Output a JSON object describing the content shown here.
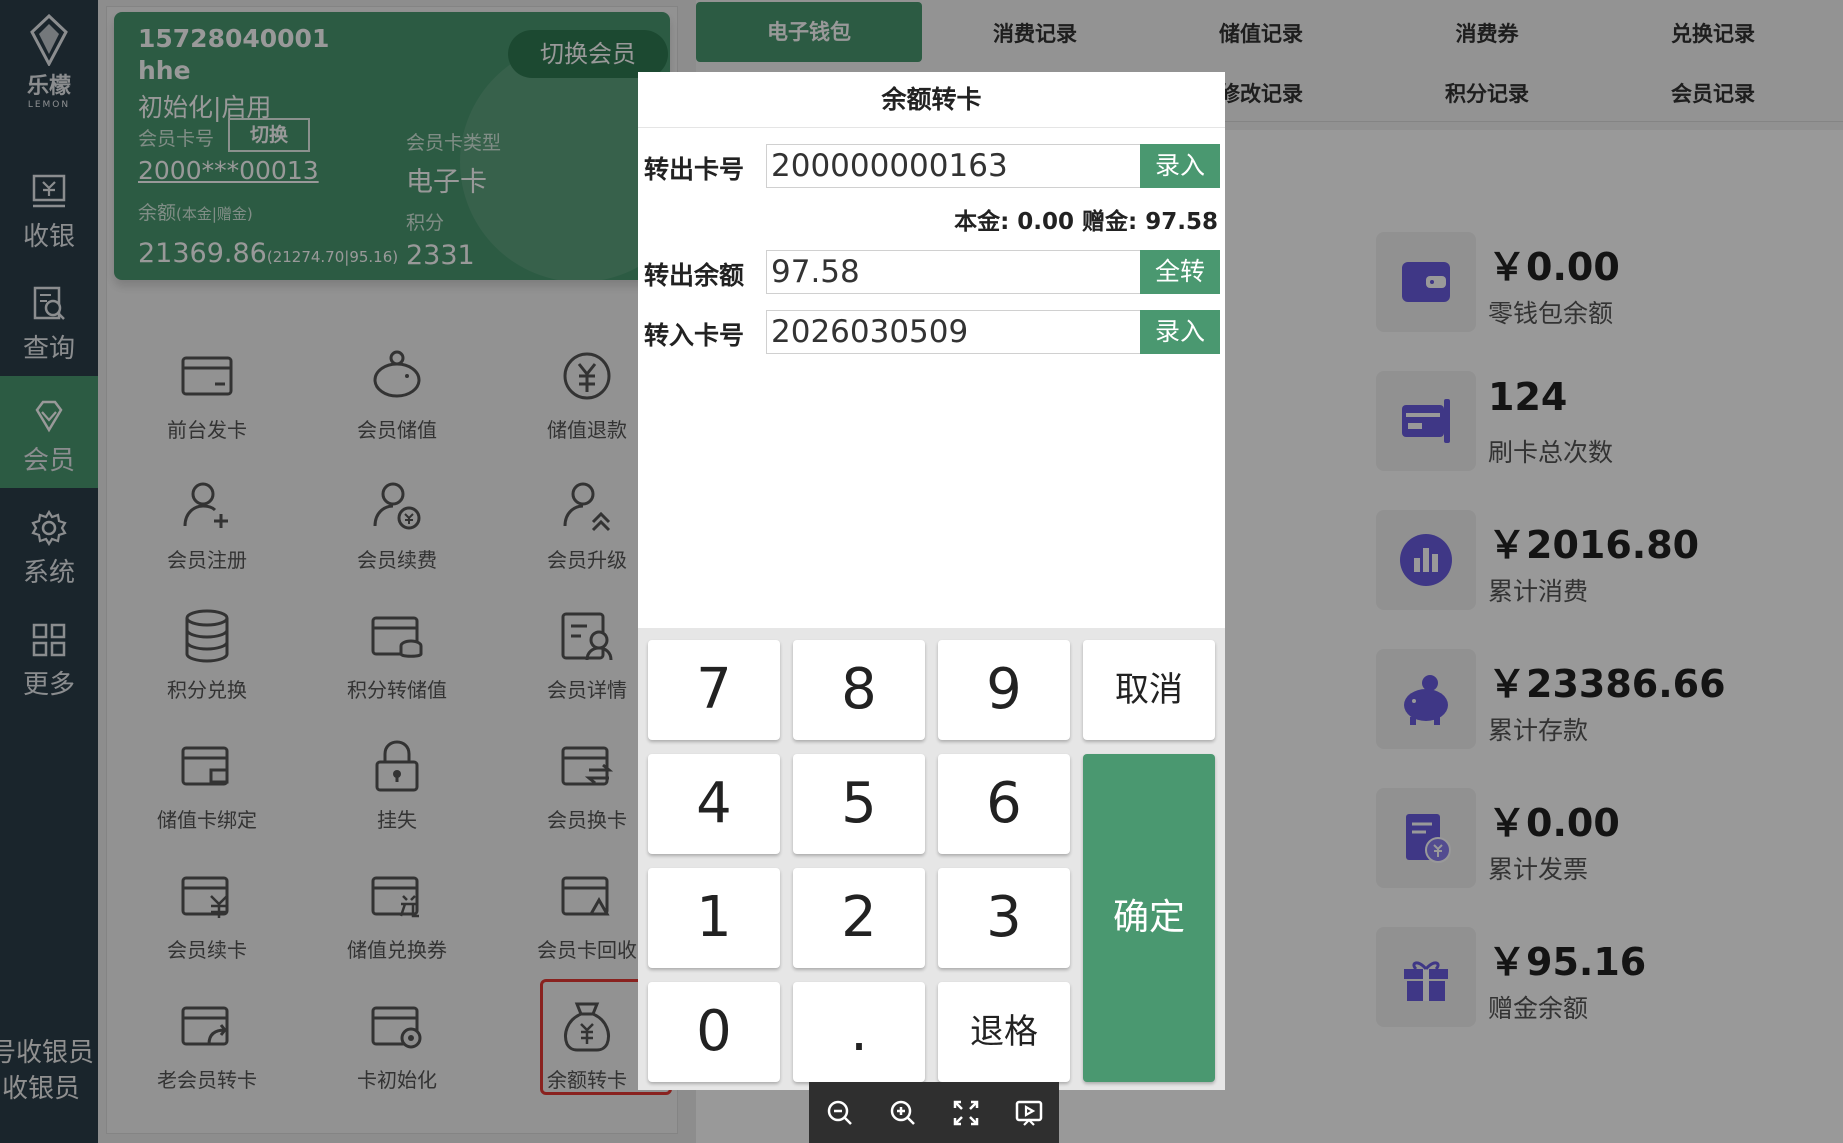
{
  "nav": {
    "logo_cn": "乐檬",
    "logo_en": "LEMON",
    "items": [
      {
        "label": "收银"
      },
      {
        "label": "查询"
      },
      {
        "label": "会员"
      },
      {
        "label": "系统"
      },
      {
        "label": "更多"
      }
    ],
    "cashier_line1": "号收银员",
    "cashier_line2": "收银员"
  },
  "card": {
    "phone": "15728040001",
    "name": "hhe",
    "status": "初始化|启用",
    "card_no_label": "会员卡号",
    "switch_label": "切换",
    "card_no": "2000***00013",
    "card_type_label": "会员卡类型",
    "card_type": "电子卡",
    "balance_label": "余额",
    "balance_sub": "(本金|赠金)",
    "balance": "21369.86",
    "balance_detail": "(21274.70|95.16)",
    "points_label": "积分",
    "points": "2331",
    "switch_member_label": "切换会员"
  },
  "tiles": [
    {
      "label": "前台发卡",
      "icon": "card-icon"
    },
    {
      "label": "会员储值",
      "icon": "piggy-bank-icon"
    },
    {
      "label": "储值退款",
      "icon": "yuan-refund-icon"
    },
    {
      "label": "会员注册",
      "icon": "user-add-icon"
    },
    {
      "label": "会员续费",
      "icon": "user-yuan-icon"
    },
    {
      "label": "会员升级",
      "icon": "user-upgrade-icon"
    },
    {
      "label": "积分兑换",
      "icon": "coins-stack-icon"
    },
    {
      "label": "积分转储值",
      "icon": "card-transfer-icon"
    },
    {
      "label": "会员详情",
      "icon": "user-detail-icon"
    },
    {
      "label": "储值卡绑定",
      "icon": "card-bind-icon"
    },
    {
      "label": "挂失",
      "icon": "lock-icon"
    },
    {
      "label": "会员换卡",
      "icon": "card-swap-icon"
    },
    {
      "label": "会员续卡",
      "icon": "card-renew-icon"
    },
    {
      "label": "储值兑换券",
      "icon": "card-coupon-icon"
    },
    {
      "label": "会员卡回收",
      "icon": "card-recycle-icon"
    },
    {
      "label": "老会员转卡",
      "icon": "card-forward-icon"
    },
    {
      "label": "卡初始化",
      "icon": "card-reset-icon"
    },
    {
      "label": "余额转卡",
      "icon": "money-bag-icon"
    }
  ],
  "tabs": [
    {
      "label": "电子钱包"
    },
    {
      "label": "消费记录"
    },
    {
      "label": "储值记录"
    },
    {
      "label": "消费券"
    },
    {
      "label": "兑换记录"
    },
    {
      "label": "修改记录"
    },
    {
      "label": "积分记录"
    },
    {
      "label": "会员记录"
    }
  ],
  "stats": [
    {
      "value": "￥0.00",
      "label": "零钱包余额",
      "icon": "wallet-icon"
    },
    {
      "value": "124",
      "label": "刷卡总次数",
      "icon": "card-swipe-icon"
    },
    {
      "value": "￥2016.80",
      "label": "累计消费",
      "icon": "bar-chart-icon"
    },
    {
      "value": "￥23386.66",
      "label": "累计存款",
      "icon": "piggy-bank-icon"
    },
    {
      "value": "￥0.00",
      "label": "累计发票",
      "icon": "invoice-icon"
    },
    {
      "value": "￥95.16",
      "label": "赠金余额",
      "icon": "gift-icon"
    }
  ],
  "dialog": {
    "title": "余额转卡",
    "out_card_label": "转出卡号",
    "out_card_value": "200000000163",
    "enter_label": "录入",
    "balance_info": "本金:  0.00 赠金:  97.58",
    "out_amount_label": "转出余额",
    "out_amount_value": "97.58",
    "all_label": "全转",
    "in_card_label": "转入卡号",
    "in_card_value": "2026030509",
    "keys": {
      "k7": "7",
      "k8": "8",
      "k9": "9",
      "cancel": "取消",
      "k4": "4",
      "k5": "5",
      "k6": "6",
      "ok": "确定",
      "k1": "1",
      "k2": "2",
      "k3": "3",
      "k0": "0",
      "dot": ".",
      "back": "退格"
    }
  },
  "colors": {
    "accent": "#4a9870",
    "nav_bg": "#2c3e4a",
    "highlight": "#e53935"
  }
}
